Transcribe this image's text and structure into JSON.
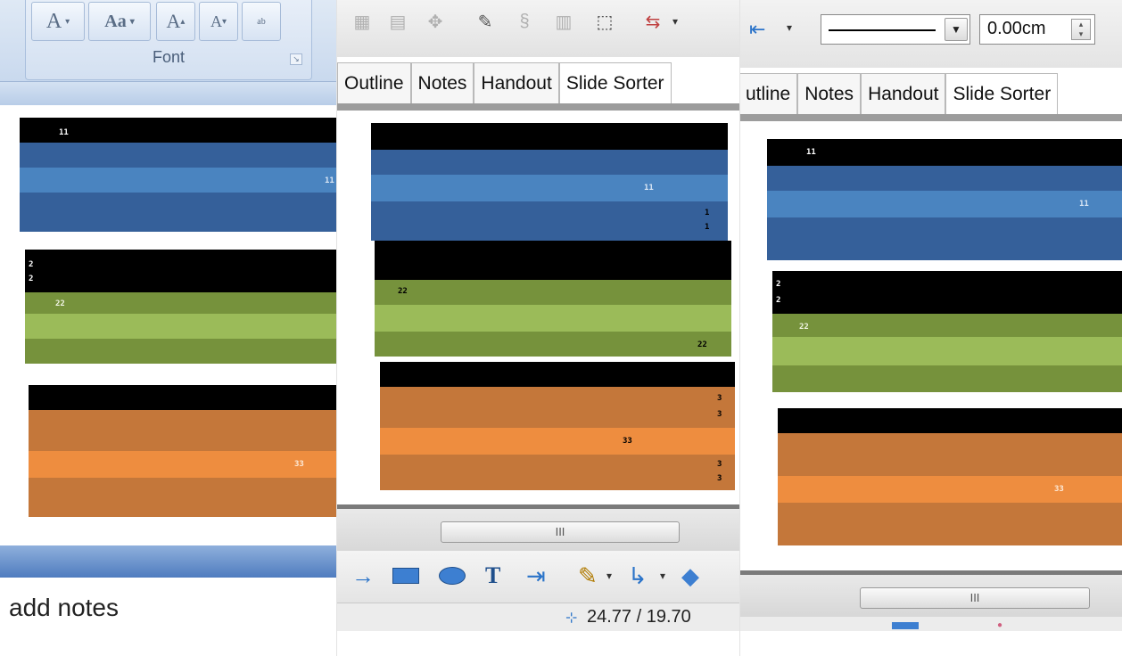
{
  "panel1": {
    "group_label": "Font",
    "font_buttons": [
      "A",
      "Aa",
      "A",
      "A",
      "ab"
    ],
    "add_notes": "add notes"
  },
  "panel2": {
    "tabs": [
      "Outline",
      "Notes",
      "Handout",
      "Slide Sorter"
    ],
    "scroll_thumb": "III",
    "coordinates": "24.77 / 19.70"
  },
  "panel3": {
    "tabs": [
      "utline",
      "Notes",
      "Handout",
      "Slide Sorter"
    ],
    "spin_value": "0.00cm",
    "scroll_thumb": "III"
  },
  "slide_labels": {
    "p1": {
      "s1_header": "11",
      "s1_mid": "11",
      "s2_header_a": "2",
      "s2_header_b": "2",
      "s2_mid": "22",
      "s3_mid": "33"
    },
    "p2": {
      "s1_mid": "11",
      "s1_low_a": "1",
      "s1_low_b": "1",
      "s2_top": "22",
      "s2_bottom": "22",
      "s3_top_a": "3",
      "s3_top_b": "3",
      "s3_mid": "33",
      "s3_low_a": "3",
      "s3_low_b": "3"
    },
    "p3": {
      "s1_header": "11",
      "s1_mid": "11",
      "s2_header_a": "2",
      "s2_header_b": "2",
      "s2_mid": "22",
      "s3_mid": "33"
    }
  },
  "colors": {
    "black": "#000000",
    "blue_dark": "#35609a",
    "blue_light": "#4a84c0",
    "green_dark": "#76923c",
    "green_light": "#9bbb59",
    "orange_dark": "#c4773a",
    "orange_light": "#ee8d3f"
  }
}
